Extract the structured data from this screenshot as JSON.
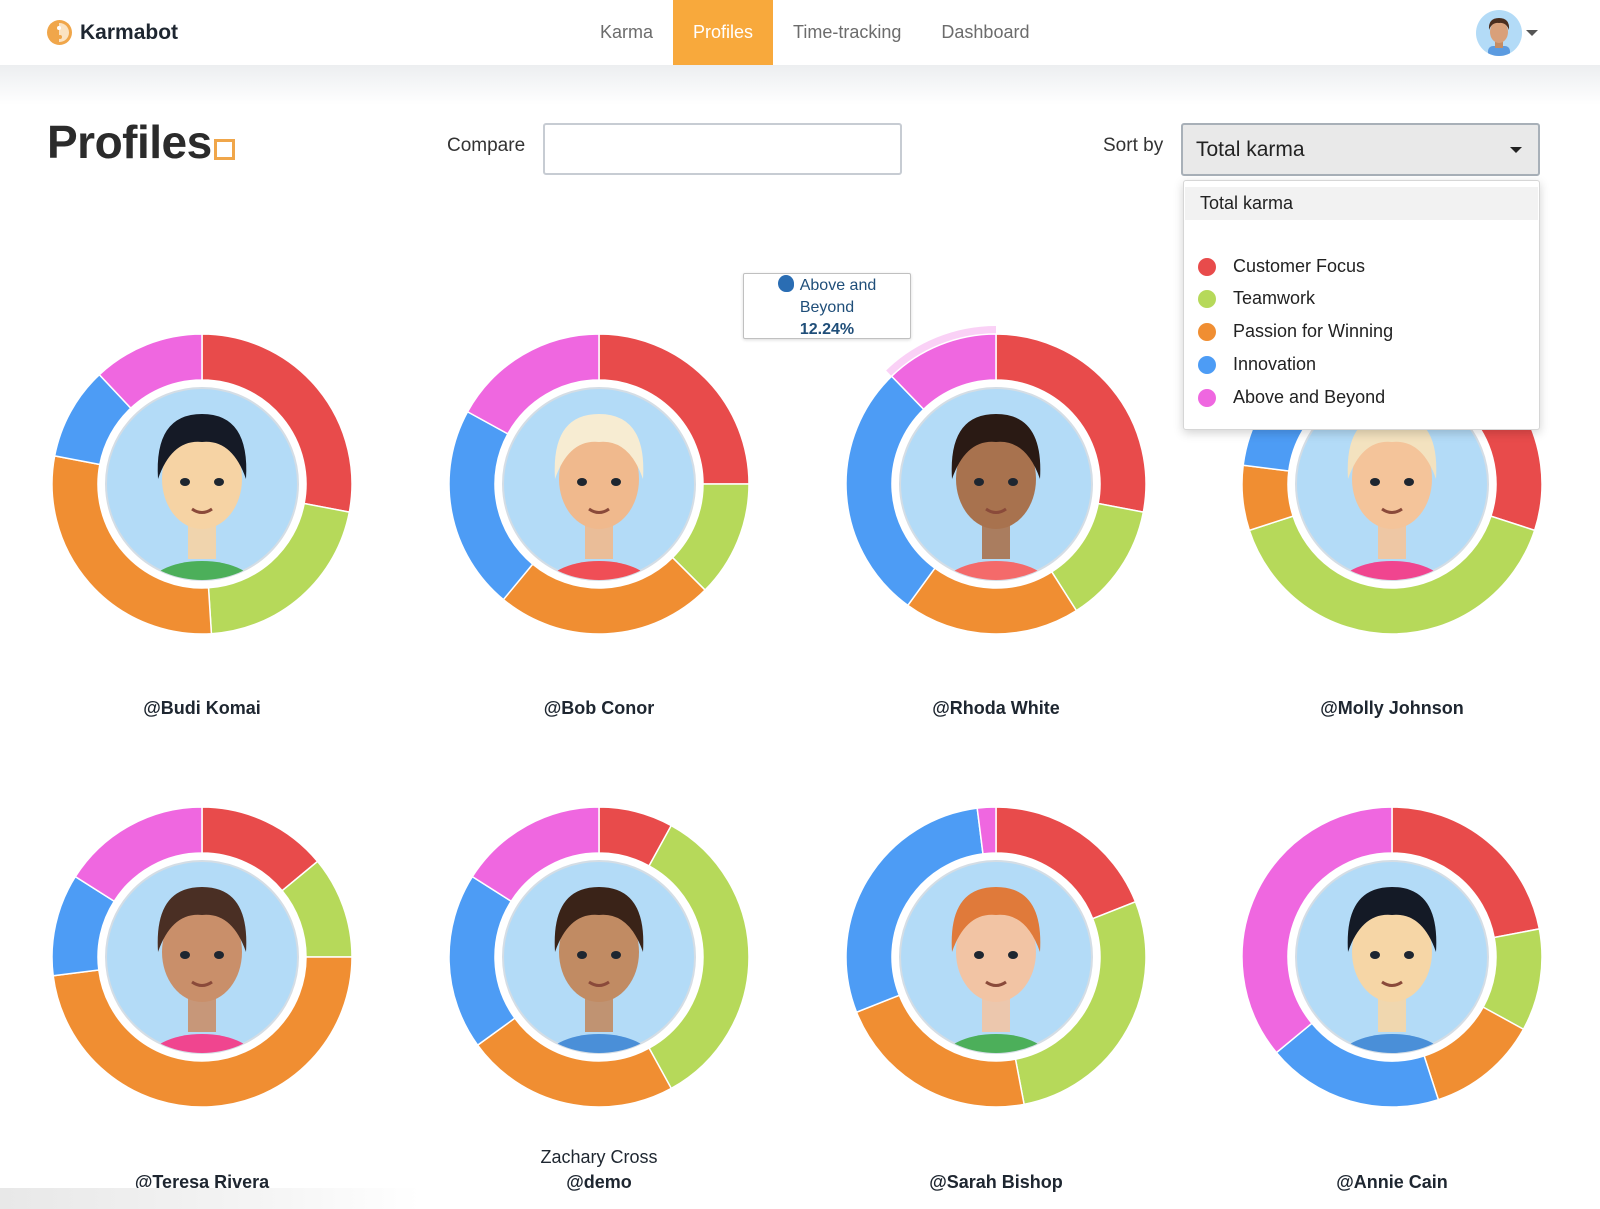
{
  "app": {
    "brand_name": "Karmabot",
    "logo_icon": "yin-yang-icon"
  },
  "nav": {
    "links": [
      {
        "label": "Karma",
        "active": false
      },
      {
        "label": "Profiles",
        "active": true
      },
      {
        "label": "Time-tracking",
        "active": false
      },
      {
        "label": "Dashboard",
        "active": false
      }
    ],
    "user_menu_icon": "avatar-with-caret"
  },
  "page": {
    "title": "Profiles",
    "compare_label": "Compare",
    "compare_value": "",
    "compare_placeholder": "",
    "sort_label": "Sort by",
    "sort_value": "Total karma"
  },
  "sort_dropdown": {
    "selected": "Total karma",
    "options": [
      {
        "label": "Customer Focus",
        "color": "#e84b4b"
      },
      {
        "label": "Teamwork",
        "color": "#b6d95a"
      },
      {
        "label": "Passion for Winning",
        "color": "#f08e32"
      },
      {
        "label": "Innovation",
        "color": "#4d9cf5"
      },
      {
        "label": "Above and Beyond",
        "color": "#ef67e0"
      }
    ]
  },
  "tooltip": {
    "category": "Above and Beyond",
    "line1": "Above and",
    "line2": "Beyond",
    "value": "12.24%",
    "icon": "speaking-head-icon"
  },
  "chart_data": {
    "type": "pie",
    "variant": "donut",
    "start_angle": "12 o'clock, clockwise",
    "categories": [
      "Customer Focus",
      "Teamwork",
      "Passion for Winning",
      "Innovation",
      "Above and Beyond"
    ],
    "colors": [
      "#e84b4b",
      "#b6d95a",
      "#f08e32",
      "#4d9cf5",
      "#ef67e0"
    ],
    "profiles": [
      {
        "handle": "@Budi Komai",
        "full_name": "",
        "avatar": "man-black-hair-green-shirt",
        "values": [
          28,
          21,
          29,
          10,
          12
        ]
      },
      {
        "handle": "@Bob Conor",
        "full_name": "",
        "avatar": "man-blond-hair-red-shirt",
        "values": [
          25,
          12.5,
          23.5,
          22,
          17
        ]
      },
      {
        "handle": "@Rhoda White",
        "full_name": "",
        "avatar": "woman-dark-hair-coral-shirt",
        "values": [
          28,
          13,
          19,
          27.76,
          12.24
        ],
        "highlighted_segment": 4
      },
      {
        "handle": "@Molly Johnson",
        "full_name": "",
        "avatar": "woman-blonde-bob-pink-top",
        "values": [
          30,
          40,
          7,
          13,
          10
        ]
      },
      {
        "handle": "@Teresa Rivera",
        "full_name": "",
        "avatar": "woman-glasses-pink-top",
        "values": [
          14,
          11,
          48,
          11,
          16
        ]
      },
      {
        "handle": "@demo",
        "full_name": "Zachary Cross",
        "avatar": "man-curly-hair-blue-sweater",
        "values": [
          8,
          34,
          23,
          19,
          16
        ]
      },
      {
        "handle": "@Sarah Bishop",
        "full_name": "",
        "avatar": "woman-red-hair-green-shirt",
        "values": [
          19,
          28,
          22,
          29,
          2
        ]
      },
      {
        "handle": "@Annie Cain",
        "full_name": "",
        "avatar": "woman-black-bangs-blue-sweater",
        "values": [
          22,
          11,
          12,
          19,
          36
        ]
      }
    ]
  }
}
